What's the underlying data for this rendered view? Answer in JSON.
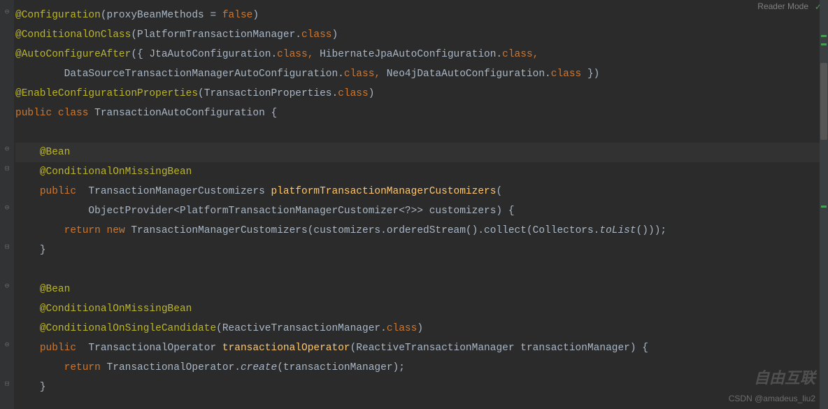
{
  "header": {
    "reader_mode": "Reader Mode"
  },
  "code": {
    "ann_configuration": "@Configuration",
    "proxy_bean_methods": "proxyBeanMethods = ",
    "false": "false",
    "ann_conditional_on_class": "@ConditionalOnClass",
    "platform_tm": "PlatformTransactionManager.",
    "class_kw": "class",
    "ann_auto_configure_after": "@AutoConfigureAfter",
    "jta_auto": "{ JtaAutoConfiguration.",
    "comma_sp": ", ",
    "hibernate_jpa": " HibernateJpaAutoConfiguration.",
    "comma": ",",
    "ds_tm_auto": "        DataSourceTransactionManagerAutoConfiguration.",
    "neo4j": " Neo4jDataAutoConfiguration.",
    "close_arr": " })",
    "ann_enable_config_props": "@EnableConfigurationProperties",
    "transaction_props": "TransactionProperties.",
    "public": "public ",
    "class_sp": "class ",
    "transaction_auto_config": "TransactionAutoConfiguration {",
    "ann_bean": "@Bean",
    "ann_conditional_missing": "@ConditionalOnMissingBean",
    "tm_customizers": " TransactionManagerCustomizers ",
    "platform_tm_customizers": "platformTransactionManagerCustomizers",
    "obj_provider": "        ObjectProvider<PlatformTransactionManagerCustomizer<?>> customizers) {",
    "return": "return ",
    "new": "new ",
    "tm_customizers2": "TransactionManagerCustomizers(customizers.orderedStream().collect(Collectors.",
    "to_list": "toList",
    "end_paren3": "()));",
    "close_brace": "}",
    "ann_conditional_single": "@ConditionalOnSingleCandidate",
    "reactive_tm": "ReactiveTransactionManager.",
    "transactional_op": " TransactionalOperator ",
    "transactional_op_m": "transactionalOperator",
    "reactive_tm_param": "(ReactiveTransactionManager transactionManager) {",
    "transactional_op2": "TransactionalOperator.",
    "create": "create",
    "tm_arg": "(transactionManager);"
  },
  "watermark": {
    "logo": "自由互联",
    "attribution": "CSDN @amadeus_liu2"
  }
}
